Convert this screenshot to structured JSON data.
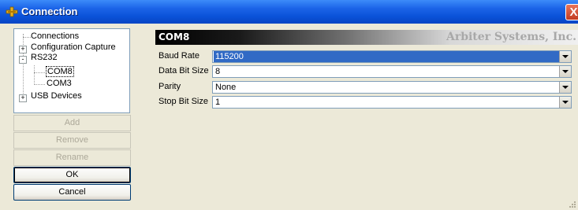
{
  "window": {
    "title": "Connection",
    "close_label": "X"
  },
  "tree": {
    "items": [
      {
        "label": "Connections"
      },
      {
        "label": "Configuration Capture",
        "expander": "+"
      },
      {
        "label": "RS232",
        "expander": "-"
      },
      {
        "label": "COM8",
        "selected": true
      },
      {
        "label": "COM3"
      },
      {
        "label": "USB Devices",
        "expander": "+"
      }
    ]
  },
  "buttons": {
    "add": "Add",
    "remove": "Remove",
    "rename": "Rename",
    "ok": "OK",
    "cancel": "Cancel"
  },
  "panel": {
    "port": "COM8",
    "brand": "Arbiter Systems, Inc.",
    "fields": [
      {
        "label": "Baud Rate",
        "value": "115200"
      },
      {
        "label": "Data Bit Size",
        "value": "8"
      },
      {
        "label": "Parity",
        "value": "None"
      },
      {
        "label": "Stop Bit Size",
        "value": "1"
      }
    ]
  },
  "colors": {
    "titlebar": "#0a52d8",
    "selection": "#316ac5",
    "window_bg": "#ece9d8"
  }
}
